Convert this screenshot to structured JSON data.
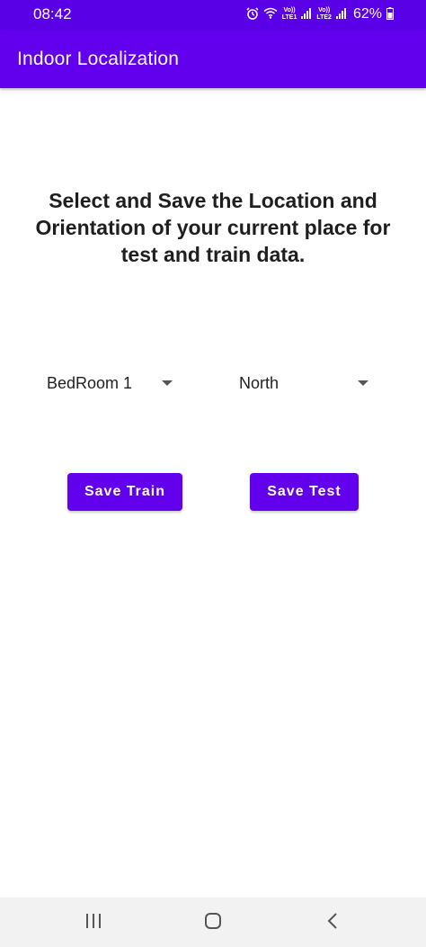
{
  "status_bar": {
    "time": "08:42",
    "alarm_icon": "alarm-icon",
    "wifi_icon": "wifi-icon",
    "sim1_label_top": "Vo))",
    "sim1_label_bottom": "LTE1",
    "sim2_label_top": "Vo))",
    "sim2_label_bottom": "LTE2",
    "battery": "62%",
    "color": "#5a00e6"
  },
  "app_bar": {
    "title": "Indoor Localization",
    "color": "#6200ee"
  },
  "main": {
    "heading": "Select and Save the Location and Orientation of your current place for test and train data.",
    "location_spinner": {
      "selected": "BedRoom 1"
    },
    "orientation_spinner": {
      "selected": "North"
    },
    "save_train_label": "Save Train",
    "save_test_label": "Save Test",
    "accent": "#6200ee"
  },
  "nav_bar": {
    "recents_icon": "recents-icon",
    "home_icon": "home-icon",
    "back_icon": "back-icon"
  }
}
